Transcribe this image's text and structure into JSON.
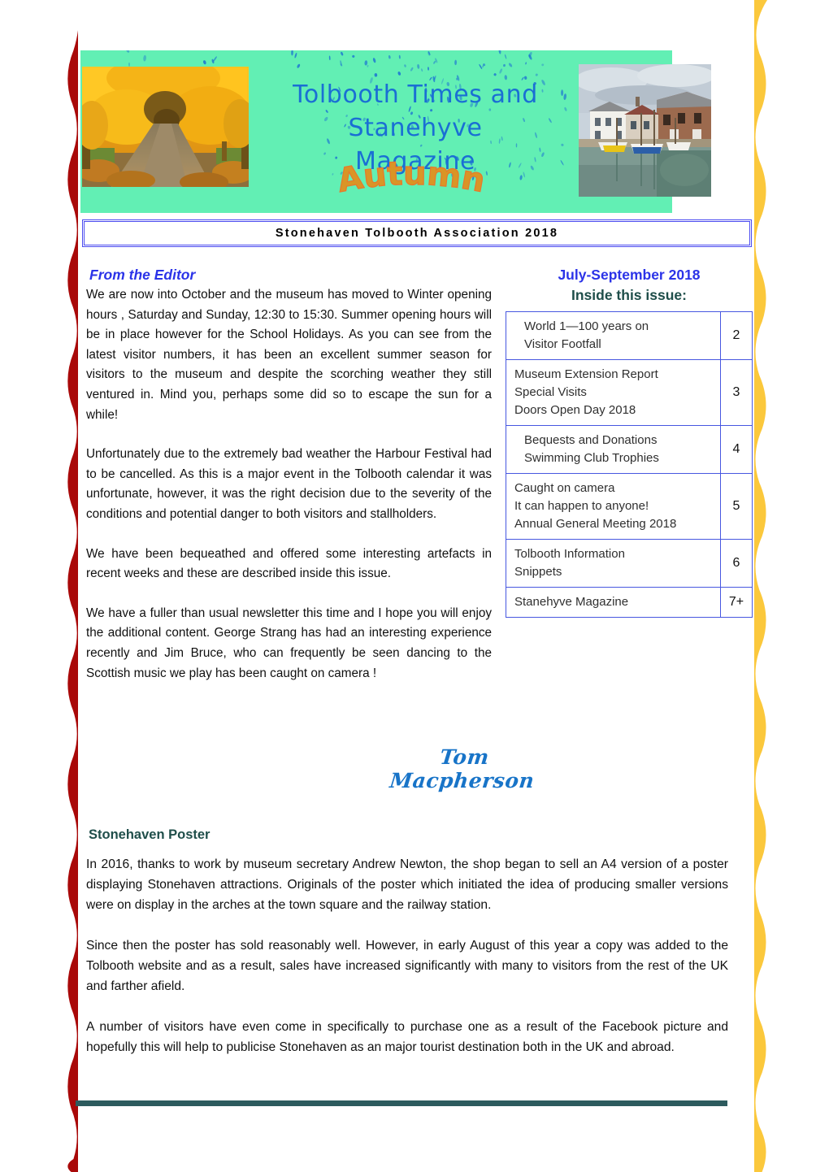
{
  "colors": {
    "left_band": "#a90909",
    "right_band": "#fbc83c",
    "header_green": "#62efb4",
    "title_blue": "#1a6fd4",
    "autumn_orange": "#d99526",
    "border_blue": "#4b4bf0",
    "heading_blue": "#2b33e8",
    "heading_teal": "#1f4e4a",
    "signature_blue": "#1874c8",
    "rule_teal": "#2d5b5e"
  },
  "header": {
    "title_line_1": "Tolbooth Times and Stanehyve",
    "title_line_2": "Magazine",
    "season_word": "Autumn",
    "photo_left_name": "autumn-trees-lane-photo",
    "photo_right_name": "stonehaven-harbour-photo"
  },
  "association_bar": {
    "text": "Stonehaven Tolbooth Association 2018"
  },
  "editor": {
    "heading": "From the Editor",
    "paragraphs": [
      "We are now into October and the museum has moved to Winter opening hours , Saturday and Sunday, 12:30 to 15:30. Summer opening hours will be in place however for the School Holidays. As you can see from the latest visitor numbers, it has been an excellent summer season for visitors to the museum and despite the scorching weather  they still ventured in. Mind you, perhaps some did so to escape the sun for a while!",
      "Unfortunately  due to the extremely bad weather the Harbour Festival had to be cancelled.  As this is a major event in the Tolbooth calendar it was unfortunate, however, it was the right decision due to the severity of the conditions and potential danger to both visitors and stallholders.",
      "We have been bequeathed and offered some interesting artefacts in recent weeks and these are described inside this issue.",
      "We have a fuller than usual newsletter this time and I hope you will enjoy the additional content. George Strang has had an interesting experience recently and Jim Bruce, who can frequently  be seen dancing to the Scottish music we play has been caught on camera !"
    ],
    "signature": "Tom Macpherson"
  },
  "issue": {
    "date_range": "July-September 2018",
    "inside_label": "Inside this issue:",
    "contents": [
      {
        "topics": "World 1—100 years on\nVisitor Footfall",
        "page": "2",
        "indented": true
      },
      {
        "topics": "Museum Extension Report\nSpecial Visits\nDoors Open Day 2018",
        "page": "3",
        "indented": false
      },
      {
        "topics": "Bequests and  Donations\nSwimming Club Trophies",
        "page": "4",
        "indented": true
      },
      {
        "topics": "Caught on camera\nIt can happen to anyone!\nAnnual General Meeting 2018",
        "page": "5",
        "indented": false
      },
      {
        "topics": "Tolbooth Information\nSnippets",
        "page": "6",
        "indented": false
      },
      {
        "topics": "Stanehyve Magazine",
        "page": "7+",
        "indented": false
      }
    ]
  },
  "poster": {
    "heading": "Stonehaven Poster",
    "paragraphs": [
      "In 2016, thanks to work by museum secretary Andrew Newton,  the shop began to sell an A4 version of  a poster displaying  Stonehaven attractions. Originals of the poster which initiated the idea of producing smaller versions were  on display in the arches at the town square and the railway station.",
      "Since then the poster has sold reasonably well. However, in early August of this year a copy was added to the Tolbooth website and as a result, sales have increased significantly  with many  to visitors from the rest of the UK and farther afield.",
      "A number of visitors have even come in specifically to purchase one as a result of the Facebook picture and hopefully this will help to publicise Stonehaven as an major tourist destination both in the UK and abroad."
    ]
  }
}
